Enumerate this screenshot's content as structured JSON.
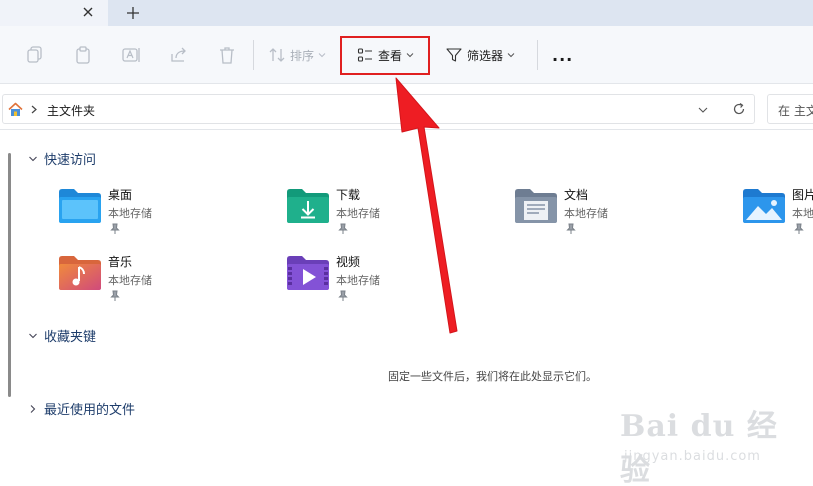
{
  "toolbar": {
    "sort_label": "排序",
    "view_label": "查看",
    "filter_label": "筛选器",
    "more_label": "..."
  },
  "address": {
    "path_label": "主文件夹"
  },
  "search": {
    "placeholder": "在 主文"
  },
  "quick_access": {
    "title": "快速访问",
    "items": [
      {
        "name": "桌面",
        "sub": "本地存储",
        "icon": "desktop-folder-icon"
      },
      {
        "name": "下载",
        "sub": "本地存储",
        "icon": "downloads-folder-icon"
      },
      {
        "name": "文档",
        "sub": "本地存储",
        "icon": "documents-folder-icon"
      },
      {
        "name": "图片",
        "sub": "本地",
        "icon": "pictures-folder-icon"
      },
      {
        "name": "音乐",
        "sub": "本地存储",
        "icon": "music-folder-icon"
      },
      {
        "name": "视频",
        "sub": "本地存储",
        "icon": "videos-folder-icon"
      }
    ]
  },
  "favorites": {
    "title": "收藏夹键",
    "empty_message": "固定一些文件后，我们将在此处显示它们。"
  },
  "recent": {
    "title": "最近使用的文件"
  },
  "watermark": {
    "main": "Bai du 经验",
    "sub": "jingyan.baidu.com"
  },
  "colors": {
    "annotation_red": "#e02020",
    "section_title": "#1e3d6b"
  }
}
